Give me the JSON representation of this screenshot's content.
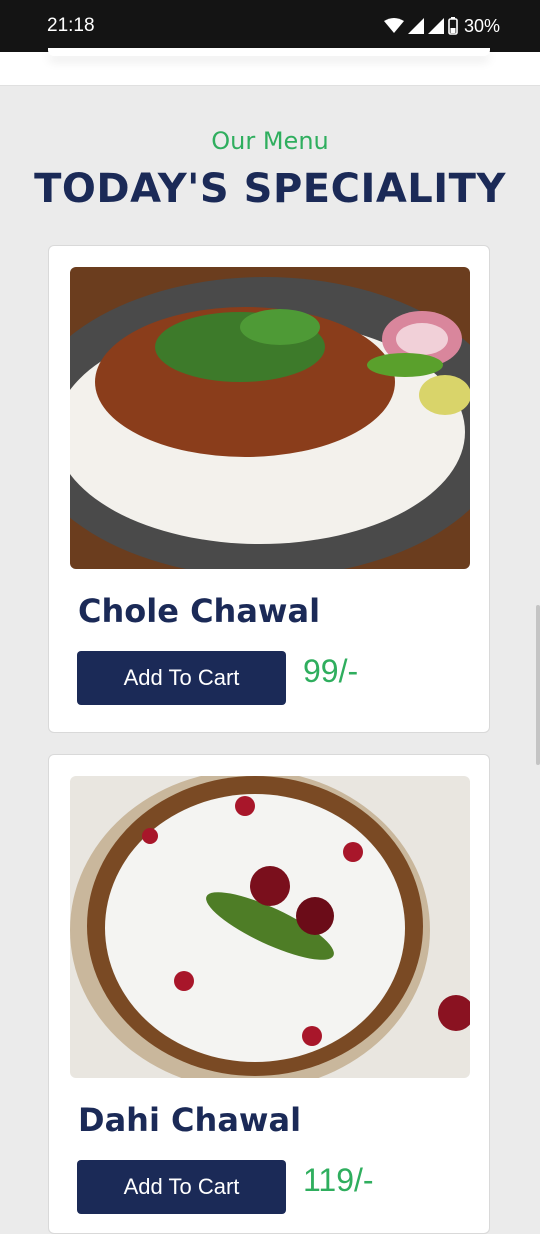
{
  "status_bar": {
    "time": "21:18",
    "battery": "30%"
  },
  "section": {
    "subtitle": "Our Menu",
    "title": "TODAY'S SPECIALITY"
  },
  "menu": [
    {
      "name": "Chole Chawal",
      "button_label": "Add To Cart",
      "price": "99/-",
      "image_icon": "chole-chawal-image"
    },
    {
      "name": "Dahi Chawal",
      "button_label": "Add To Cart",
      "price": "119/-",
      "image_icon": "dahi-chawal-image"
    }
  ],
  "colors": {
    "accent_green": "#2fae5e",
    "brand_navy": "#1b2a57",
    "page_background": "#ebebeb"
  }
}
